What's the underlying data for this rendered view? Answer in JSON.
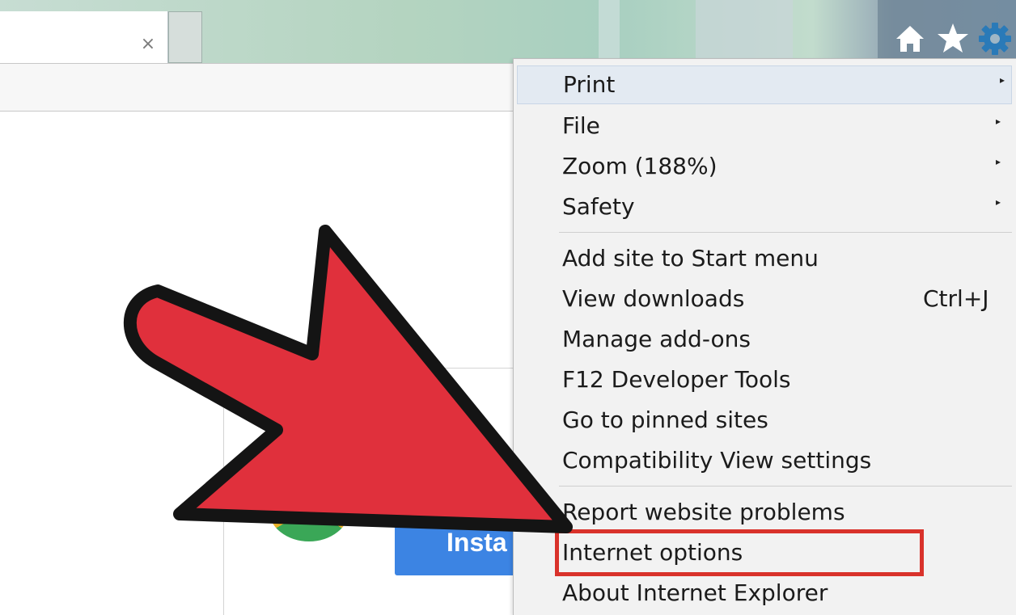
{
  "tab": {
    "close_symbol": "×"
  },
  "toolbar": {
    "home_icon": "home-icon",
    "favorites_icon": "star-icon",
    "tools_icon": "gear-icon",
    "accent": "#2a7ab8"
  },
  "page": {
    "install_button_label": "Insta"
  },
  "menu": {
    "items": [
      {
        "label": "Print",
        "submenu": true
      },
      {
        "label": "File",
        "submenu": true
      },
      {
        "label": "Zoom (188%)",
        "submenu": true
      },
      {
        "label": "Safety",
        "submenu": true
      },
      {
        "label": "Add site to Start menu"
      },
      {
        "label": "View downloads",
        "shortcut": "Ctrl+J"
      },
      {
        "label": "Manage add-ons"
      },
      {
        "label": "F12 Developer Tools"
      },
      {
        "label": "Go to pinned sites"
      },
      {
        "label": "Compatibility View settings"
      },
      {
        "label": "Report website problems"
      },
      {
        "label": "Internet options",
        "highlighted": true
      },
      {
        "label": "About Internet Explorer"
      }
    ],
    "submenu_arrow": "▸",
    "highlight_color": "#d9322b"
  },
  "annotation": {
    "arrow_color": "#e0303c"
  }
}
